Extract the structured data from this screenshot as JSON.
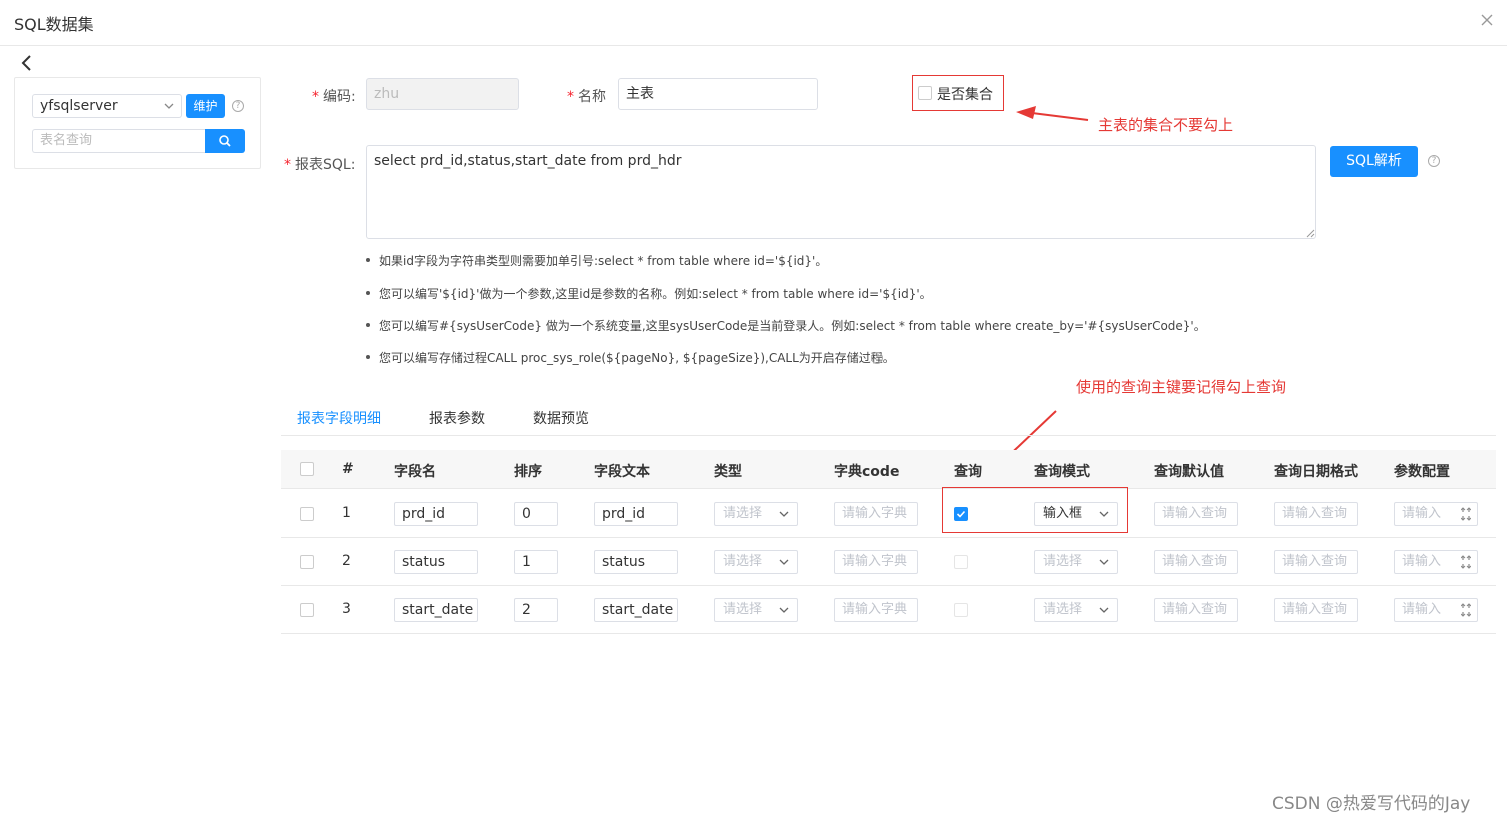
{
  "dialog": {
    "title": "SQL数据集"
  },
  "sidebar": {
    "datasource_value": "yfsqlserver",
    "maintain_label": "维护",
    "table_search_placeholder": "表名查询"
  },
  "form": {
    "code_label": "编码:",
    "code_value": "zhu",
    "name_label": "名称",
    "name_value": "主表",
    "is_collection_label": "是否集合",
    "sql_label": "报表SQL:",
    "sql_value": "select prd_id,status,start_date from prd_hdr",
    "sql_parse_label": "SQL解析"
  },
  "tips": [
    "如果id字段为字符串类型则需要加单引号:select * from table where id='${id}'。",
    "您可以编写'${id}'做为一个参数,这里id是参数的名称。例如:select * from table where id='${id}'。",
    "您可以编写#{sysUserCode} 做为一个系统变量,这里sysUserCode是当前登录人。例如:select * from table where create_by='#{sysUserCode}'。",
    "您可以编写存储过程CALL proc_sys_role(${pageNo}, ${pageSize}),CALL为开启存储过程。"
  ],
  "annotations": {
    "collection_note": "主表的集合不要勾上",
    "query_note": "使用的查询主键要记得勾上查询"
  },
  "tabs": [
    {
      "label": "报表字段明细",
      "active": true
    },
    {
      "label": "报表参数",
      "active": false
    },
    {
      "label": "数据预览",
      "active": false
    }
  ],
  "table": {
    "headers": [
      "#",
      "字段名",
      "排序",
      "字段文本",
      "类型",
      "字典code",
      "查询",
      "查询模式",
      "查询默认值",
      "查询日期格式",
      "参数配置"
    ],
    "placeholders": {
      "type": "请选择",
      "dict": "请输入字典",
      "query_mode": "请选择",
      "query_default": "请输入查询",
      "date_format": "请输入查询",
      "param": "请输入"
    },
    "rows": [
      {
        "index": "1",
        "field": "prd_id",
        "order": "0",
        "text": "prd_id",
        "query": true,
        "query_mode": "输入框"
      },
      {
        "index": "2",
        "field": "status",
        "order": "1",
        "text": "status",
        "query": false,
        "query_mode": ""
      },
      {
        "index": "3",
        "field": "start_date",
        "order": "2",
        "text": "start_date",
        "query": false,
        "query_mode": ""
      }
    ]
  },
  "watermark": "CSDN @热爱写代码的Jay",
  "colors": {
    "primary": "#1890ff",
    "annotation": "#e53935",
    "required": "#f5222d"
  }
}
